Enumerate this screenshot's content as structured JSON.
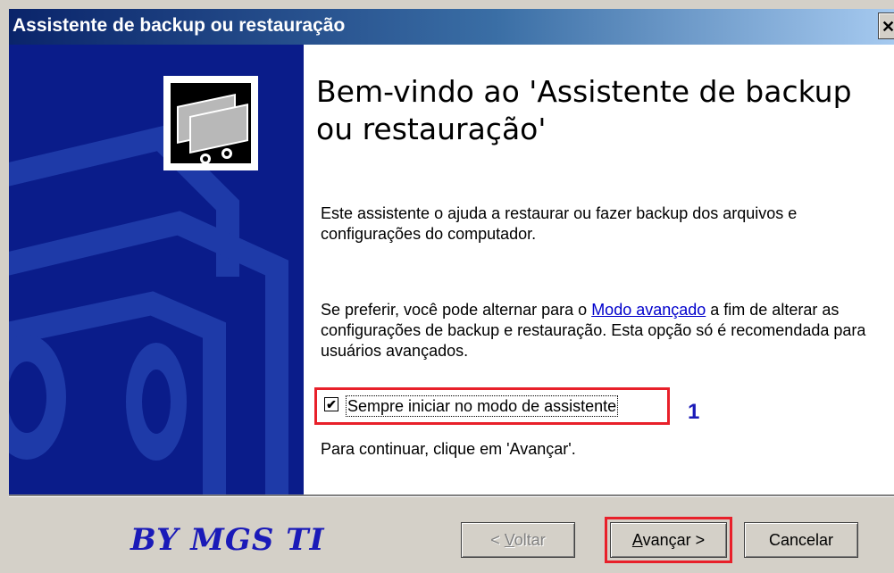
{
  "window": {
    "title": "Assistente de backup ou restauração",
    "close_glyph": "✕"
  },
  "content": {
    "heading": "Bem-vindo ao 'Assistente de backup ou restauração'",
    "intro": "Este assistente o ajuda a restaurar ou fazer backup dos arquivos e configurações do computador.",
    "advanced_prefix": "Se preferir, você pode alternar para o ",
    "advanced_link": "Modo avançado",
    "advanced_suffix": " a fim de alterar as configurações de backup e restauração. Esta opção só é recomendada para usuários avançados.",
    "checkbox": {
      "label": "Sempre iniciar no modo de assistente",
      "checked": true,
      "check_glyph": "✔"
    },
    "annotation_marker": "1",
    "continue_text": "Para continuar, clique em 'Avançar'."
  },
  "footer": {
    "brand": "BY MGS TI",
    "back_label_mnemonic": "V",
    "back_label_prefix": "< ",
    "back_label_rest": "oltar",
    "next_label_mnemonic": "A",
    "next_label_rest": "vançar >",
    "cancel_label": "Cancelar"
  },
  "colors": {
    "titlebar_start": "#0a246a",
    "side_panel": "#0a1c8a",
    "highlight": "#e8202a",
    "brand": "#1a1ab8",
    "link": "#0000cc"
  }
}
